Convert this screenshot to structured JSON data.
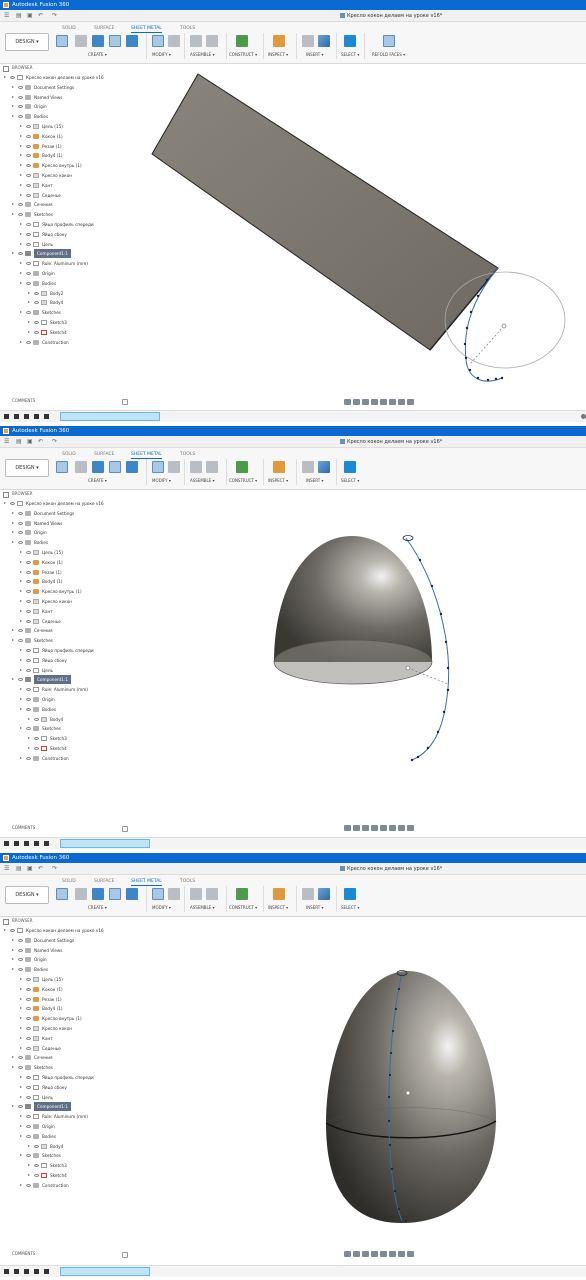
{
  "app_title": "Autodesk Fusion 360",
  "doc_tab": "Кресло кокон делаем на уроке v16*",
  "workspace_button": "DESIGN ▾",
  "tabs": [
    "SOLID",
    "SURFACE",
    "SHEET METAL",
    "TOOLS"
  ],
  "groups": {
    "create": "CREATE ▾",
    "modify": "MODIFY ▾",
    "assemble": "ASSEMBLE ▾",
    "construct": "CONSTRUCT ▾",
    "inspect": "INSPECT ▾",
    "insert": "INSERT ▾",
    "select": "SELECT ▾",
    "refold": "REFOLD FACES ▾"
  },
  "browser_title": "BROWSER",
  "comments_label": "COMMENTS",
  "tree1": [
    {
      "label": "Кресло кокон делаем на уроке v16",
      "ico": "doc",
      "level": 0
    },
    {
      "label": "Document Settings",
      "ico": "folder",
      "level": 1
    },
    {
      "label": "Named Views",
      "ico": "folder",
      "level": 1
    },
    {
      "label": "Origin",
      "ico": "folder",
      "level": 1
    },
    {
      "label": "Bodies",
      "ico": "folder",
      "level": 1
    },
    {
      "label": "Цель (15)",
      "ico": "bodyg",
      "level": 2
    },
    {
      "label": "Кокон (1)",
      "ico": "body",
      "level": 2
    },
    {
      "label": "Резак (1)",
      "ico": "body",
      "level": 2
    },
    {
      "label": "Body4 (1)",
      "ico": "body",
      "level": 2
    },
    {
      "label": "Кресло внутрь (1)",
      "ico": "body",
      "level": 2
    },
    {
      "label": "Кресло кокон",
      "ico": "bodyg",
      "level": 2
    },
    {
      "label": "Кант",
      "ico": "bodyg",
      "level": 2
    },
    {
      "label": "Седенье",
      "ico": "bodyg",
      "level": 2
    },
    {
      "label": "Сечения",
      "ico": "folder",
      "level": 1
    },
    {
      "label": "Sketches",
      "ico": "folder",
      "level": 1
    },
    {
      "label": "Яйцо профиль спереди",
      "ico": "sketch",
      "level": 2
    },
    {
      "label": "Яйцо сбоку",
      "ico": "sketch",
      "level": 2
    },
    {
      "label": "Цель",
      "ico": "sketch",
      "level": 2
    },
    {
      "label": "Component1:1",
      "ico": "comp",
      "level": 1,
      "sel": true
    },
    {
      "label": "Rule: Aluminum (mm)",
      "ico": "doc",
      "level": 2
    },
    {
      "label": "Origin",
      "ico": "folder",
      "level": 2
    },
    {
      "label": "Bodies",
      "ico": "folder",
      "level": 2
    },
    {
      "label": "Body2",
      "ico": "bodyg",
      "level": 3
    },
    {
      "label": "Body4",
      "ico": "bodyg",
      "level": 3
    },
    {
      "label": "Sketches",
      "ico": "folder",
      "level": 2
    },
    {
      "label": "Sketch3",
      "ico": "sketch",
      "level": 3
    },
    {
      "label": "Sketch4",
      "ico": "sketchr",
      "level": 3
    },
    {
      "label": "Construction",
      "ico": "folder",
      "level": 2
    }
  ],
  "tree2": [
    {
      "label": "Кресло кокон делаем на уроке v16",
      "ico": "doc",
      "level": 0
    },
    {
      "label": "Document Settings",
      "ico": "folder",
      "level": 1
    },
    {
      "label": "Named Views",
      "ico": "folder",
      "level": 1
    },
    {
      "label": "Origin",
      "ico": "folder",
      "level": 1
    },
    {
      "label": "Bodies",
      "ico": "folder",
      "level": 1
    },
    {
      "label": "Цель (15)",
      "ico": "bodyg",
      "level": 2
    },
    {
      "label": "Кокон (1)",
      "ico": "body",
      "level": 2
    },
    {
      "label": "Резак (1)",
      "ico": "body",
      "level": 2
    },
    {
      "label": "Body4 (1)",
      "ico": "body",
      "level": 2
    },
    {
      "label": "Кресло внутрь (1)",
      "ico": "body",
      "level": 2
    },
    {
      "label": "Кресло кокон",
      "ico": "bodyg",
      "level": 2
    },
    {
      "label": "Кант",
      "ico": "bodyg",
      "level": 2
    },
    {
      "label": "Седенье",
      "ico": "bodyg",
      "level": 2
    },
    {
      "label": "Сечения",
      "ico": "folder",
      "level": 1
    },
    {
      "label": "Sketches",
      "ico": "folder",
      "level": 1
    },
    {
      "label": "Яйцо профиль спереди",
      "ico": "sketch",
      "level": 2
    },
    {
      "label": "Яйцо сбоку",
      "ico": "sketch",
      "level": 2
    },
    {
      "label": "Цель",
      "ico": "sketch",
      "level": 2
    },
    {
      "label": "Component1:1",
      "ico": "comp",
      "level": 1,
      "sel": true
    },
    {
      "label": "Rule: Aluminum (mm)",
      "ico": "doc",
      "level": 2
    },
    {
      "label": "Origin",
      "ico": "folder",
      "level": 2
    },
    {
      "label": "Bodies",
      "ico": "folder",
      "level": 2
    },
    {
      "label": "Body4",
      "ico": "bodyg",
      "level": 3
    },
    {
      "label": "Sketches",
      "ico": "folder",
      "level": 2
    },
    {
      "label": "Sketch3",
      "ico": "sketch",
      "level": 3
    },
    {
      "label": "Sketch4",
      "ico": "sketchr",
      "level": 3
    },
    {
      "label": "Construction",
      "ico": "folder",
      "level": 2
    }
  ],
  "colors": {
    "accent": "#0a6ad2",
    "selected_row": "#5f6f86"
  }
}
